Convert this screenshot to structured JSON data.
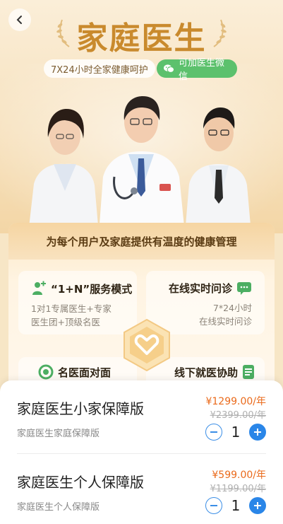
{
  "hero": {
    "title": "家庭医生",
    "subtitle": "7X24小时全家健康呵护",
    "wechat_label": "可加医生微信"
  },
  "panel": {
    "header": "为每个用户及家庭提供有温度的健康管理",
    "cards": [
      {
        "title": "“1+N”服务模式",
        "desc_line1": "1对1专属医生+专家",
        "desc_line2": "医生团+顶级名医",
        "icon": "doctor-plus-icon"
      },
      {
        "title": "在线实时问诊",
        "desc_line1": "7*24小时",
        "desc_line2": "在线实时问诊",
        "icon": "chat-bubble-icon"
      },
      {
        "title": "名医面对面",
        "icon": "video-ring-icon"
      },
      {
        "title": "线下就医协助",
        "icon": "document-icon"
      }
    ]
  },
  "products": [
    {
      "name": "家庭医生小家保障版",
      "sub": "家庭医生家庭保障版",
      "price": "¥1299.00/年",
      "original": "¥2399.00/年",
      "qty": "1"
    },
    {
      "name": "家庭医生个人保障版",
      "sub": "家庭医生个人保障版",
      "price": "¥599.00/年",
      "original": "¥1199.00/年",
      "qty": "1"
    }
  ],
  "colors": {
    "accent": "#2a86e8",
    "price": "#ea6a1b",
    "gold": "#c98a2d",
    "wechat": "#5cc16d"
  }
}
